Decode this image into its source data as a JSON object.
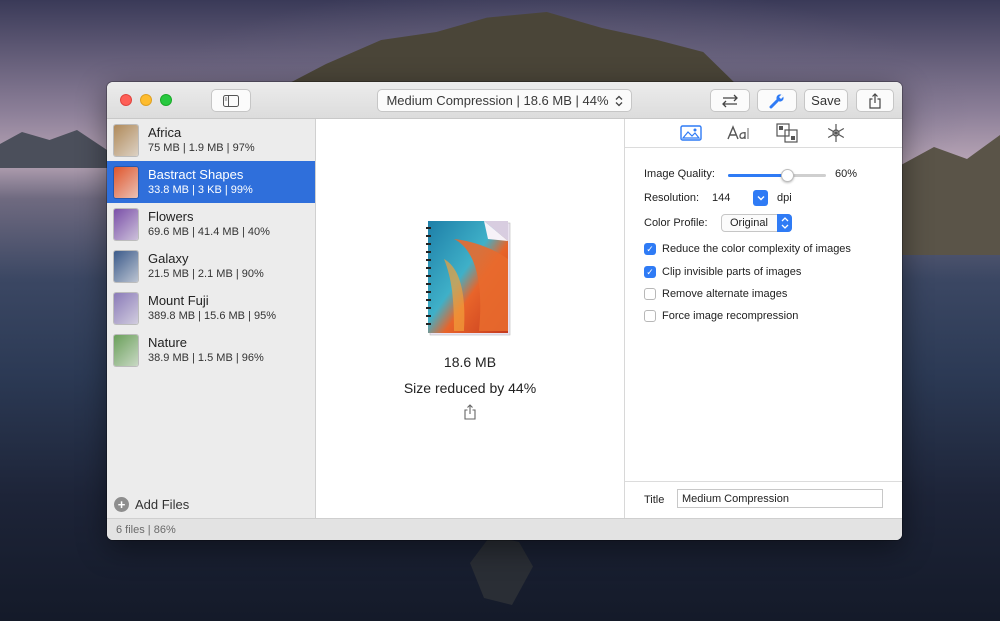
{
  "toolbar": {
    "preset_label": "Medium Compression | 18.6 MB | 44%",
    "save_label": "Save"
  },
  "files": [
    {
      "name": "Africa",
      "stats": "75 MB | 1.9 MB | 97%",
      "thumb_color": "#b08a5a"
    },
    {
      "name": "Bastract Shapes",
      "stats": "33.8 MB | 3 KB | 99%",
      "thumb_color": "#e0552b"
    },
    {
      "name": "Flowers",
      "stats": "69.6 MB | 41.4 MB | 40%",
      "thumb_color": "#7a4fa8"
    },
    {
      "name": "Galaxy",
      "stats": "21.5 MB | 2.1 MB | 90%",
      "thumb_color": "#3b5a8a"
    },
    {
      "name": "Mount Fuji",
      "stats": "389.8 MB | 15.6 MB | 95%",
      "thumb_color": "#8a7ab8"
    },
    {
      "name": "Nature",
      "stats": "38.9 MB | 1.5 MB | 96%",
      "thumb_color": "#6aa05a"
    }
  ],
  "selected_index": 1,
  "sidebar": {
    "add_files_label": "Add Files"
  },
  "preview": {
    "size": "18.6 MB",
    "reduction": "Size reduced by 44%"
  },
  "inspector": {
    "image_quality_label": "Image Quality:",
    "image_quality_value": "60%",
    "image_quality_fraction": 0.6,
    "resolution_label": "Resolution:",
    "resolution_value": "144",
    "resolution_unit": "dpi",
    "color_profile_label": "Color Profile:",
    "color_profile_value": "Original",
    "options": [
      {
        "label": "Reduce the color complexity of images",
        "checked": true
      },
      {
        "label": "Clip invisible parts of images",
        "checked": true
      },
      {
        "label": "Remove alternate images",
        "checked": false
      },
      {
        "label": "Force image recompression",
        "checked": false
      }
    ],
    "title_label": "Title",
    "title_value": "Medium Compression"
  },
  "status": {
    "text": "6 files | 86%"
  },
  "colors": {
    "accent": "#2f7bf5",
    "selection": "#2f6fdb"
  }
}
